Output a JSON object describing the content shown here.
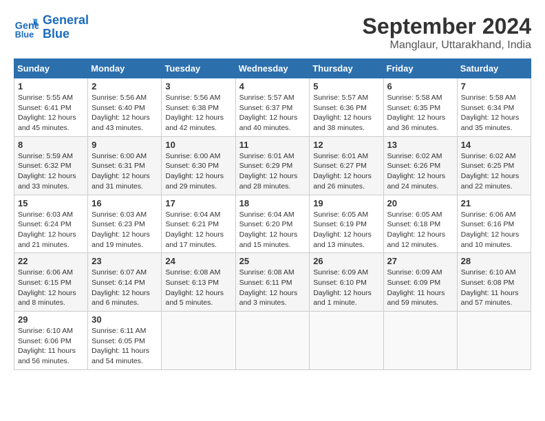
{
  "header": {
    "logo_line1": "General",
    "logo_line2": "Blue",
    "title": "September 2024",
    "subtitle": "Manglaur, Uttarakhand, India"
  },
  "columns": [
    "Sunday",
    "Monday",
    "Tuesday",
    "Wednesday",
    "Thursday",
    "Friday",
    "Saturday"
  ],
  "weeks": [
    [
      {
        "day": "1",
        "info": "Sunrise: 5:55 AM\nSunset: 6:41 PM\nDaylight: 12 hours\nand 45 minutes."
      },
      {
        "day": "2",
        "info": "Sunrise: 5:56 AM\nSunset: 6:40 PM\nDaylight: 12 hours\nand 43 minutes."
      },
      {
        "day": "3",
        "info": "Sunrise: 5:56 AM\nSunset: 6:38 PM\nDaylight: 12 hours\nand 42 minutes."
      },
      {
        "day": "4",
        "info": "Sunrise: 5:57 AM\nSunset: 6:37 PM\nDaylight: 12 hours\nand 40 minutes."
      },
      {
        "day": "5",
        "info": "Sunrise: 5:57 AM\nSunset: 6:36 PM\nDaylight: 12 hours\nand 38 minutes."
      },
      {
        "day": "6",
        "info": "Sunrise: 5:58 AM\nSunset: 6:35 PM\nDaylight: 12 hours\nand 36 minutes."
      },
      {
        "day": "7",
        "info": "Sunrise: 5:58 AM\nSunset: 6:34 PM\nDaylight: 12 hours\nand 35 minutes."
      }
    ],
    [
      {
        "day": "8",
        "info": "Sunrise: 5:59 AM\nSunset: 6:32 PM\nDaylight: 12 hours\nand 33 minutes."
      },
      {
        "day": "9",
        "info": "Sunrise: 6:00 AM\nSunset: 6:31 PM\nDaylight: 12 hours\nand 31 minutes."
      },
      {
        "day": "10",
        "info": "Sunrise: 6:00 AM\nSunset: 6:30 PM\nDaylight: 12 hours\nand 29 minutes."
      },
      {
        "day": "11",
        "info": "Sunrise: 6:01 AM\nSunset: 6:29 PM\nDaylight: 12 hours\nand 28 minutes."
      },
      {
        "day": "12",
        "info": "Sunrise: 6:01 AM\nSunset: 6:27 PM\nDaylight: 12 hours\nand 26 minutes."
      },
      {
        "day": "13",
        "info": "Sunrise: 6:02 AM\nSunset: 6:26 PM\nDaylight: 12 hours\nand 24 minutes."
      },
      {
        "day": "14",
        "info": "Sunrise: 6:02 AM\nSunset: 6:25 PM\nDaylight: 12 hours\nand 22 minutes."
      }
    ],
    [
      {
        "day": "15",
        "info": "Sunrise: 6:03 AM\nSunset: 6:24 PM\nDaylight: 12 hours\nand 21 minutes."
      },
      {
        "day": "16",
        "info": "Sunrise: 6:03 AM\nSunset: 6:23 PM\nDaylight: 12 hours\nand 19 minutes."
      },
      {
        "day": "17",
        "info": "Sunrise: 6:04 AM\nSunset: 6:21 PM\nDaylight: 12 hours\nand 17 minutes."
      },
      {
        "day": "18",
        "info": "Sunrise: 6:04 AM\nSunset: 6:20 PM\nDaylight: 12 hours\nand 15 minutes."
      },
      {
        "day": "19",
        "info": "Sunrise: 6:05 AM\nSunset: 6:19 PM\nDaylight: 12 hours\nand 13 minutes."
      },
      {
        "day": "20",
        "info": "Sunrise: 6:05 AM\nSunset: 6:18 PM\nDaylight: 12 hours\nand 12 minutes."
      },
      {
        "day": "21",
        "info": "Sunrise: 6:06 AM\nSunset: 6:16 PM\nDaylight: 12 hours\nand 10 minutes."
      }
    ],
    [
      {
        "day": "22",
        "info": "Sunrise: 6:06 AM\nSunset: 6:15 PM\nDaylight: 12 hours\nand 8 minutes."
      },
      {
        "day": "23",
        "info": "Sunrise: 6:07 AM\nSunset: 6:14 PM\nDaylight: 12 hours\nand 6 minutes."
      },
      {
        "day": "24",
        "info": "Sunrise: 6:08 AM\nSunset: 6:13 PM\nDaylight: 12 hours\nand 5 minutes."
      },
      {
        "day": "25",
        "info": "Sunrise: 6:08 AM\nSunset: 6:11 PM\nDaylight: 12 hours\nand 3 minutes."
      },
      {
        "day": "26",
        "info": "Sunrise: 6:09 AM\nSunset: 6:10 PM\nDaylight: 12 hours\nand 1 minute."
      },
      {
        "day": "27",
        "info": "Sunrise: 6:09 AM\nSunset: 6:09 PM\nDaylight: 11 hours\nand 59 minutes."
      },
      {
        "day": "28",
        "info": "Sunrise: 6:10 AM\nSunset: 6:08 PM\nDaylight: 11 hours\nand 57 minutes."
      }
    ],
    [
      {
        "day": "29",
        "info": "Sunrise: 6:10 AM\nSunset: 6:06 PM\nDaylight: 11 hours\nand 56 minutes."
      },
      {
        "day": "30",
        "info": "Sunrise: 6:11 AM\nSunset: 6:05 PM\nDaylight: 11 hours\nand 54 minutes."
      },
      {
        "day": "",
        "info": ""
      },
      {
        "day": "",
        "info": ""
      },
      {
        "day": "",
        "info": ""
      },
      {
        "day": "",
        "info": ""
      },
      {
        "day": "",
        "info": ""
      }
    ]
  ]
}
